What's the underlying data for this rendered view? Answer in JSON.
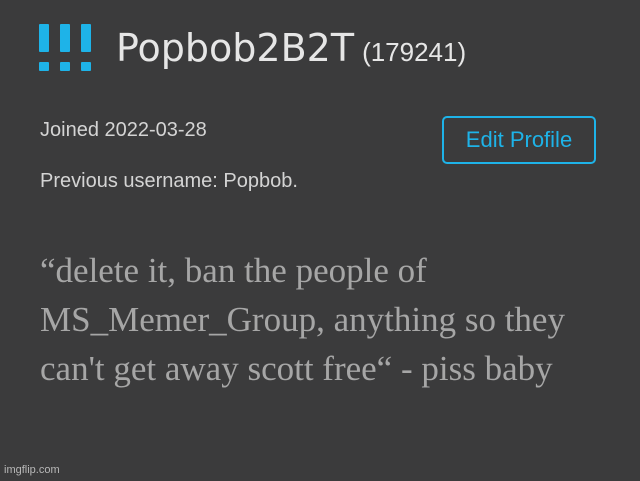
{
  "profile": {
    "logo_icon": "triple-exclamation-logo-icon",
    "username": "Popbob2B2T",
    "user_id": "(179241)",
    "joined": "Joined 2022-03-28",
    "previous_username": "Previous username: Popbob.",
    "edit_profile_label": "Edit Profile",
    "quote": "“delete it, ban the people of MS_Memer_Group, anything so they can't get away scott free“ - piss baby"
  },
  "watermark": "imgflip.com",
  "colors": {
    "background": "#3b3b3c",
    "accent": "#1eb3e8",
    "quote_text": "#a6a6a6"
  }
}
